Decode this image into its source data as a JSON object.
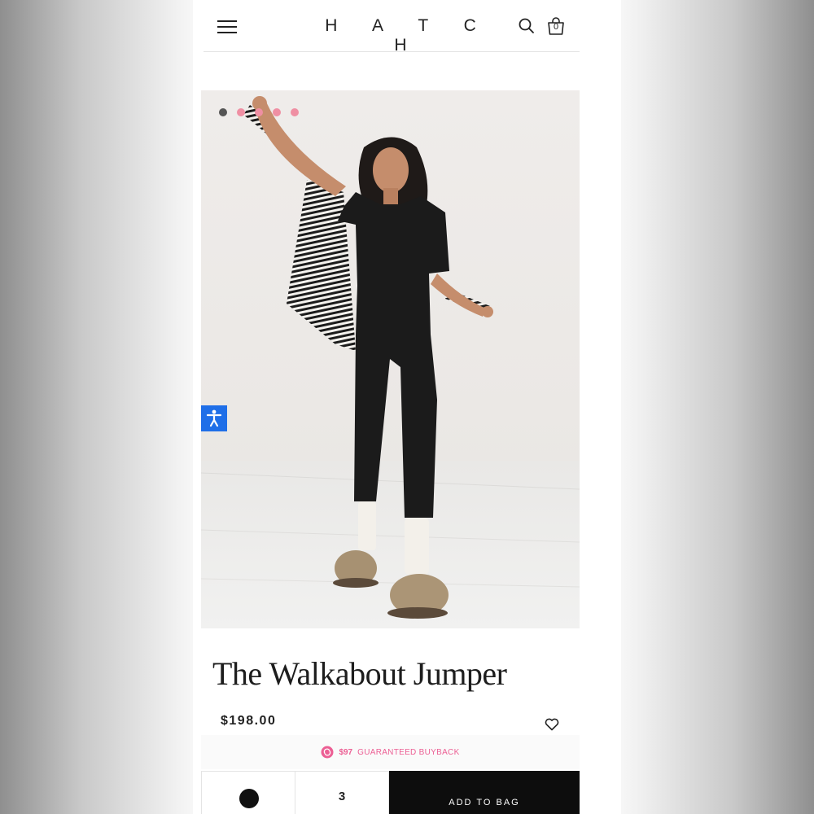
{
  "header": {
    "logo": "H A T C H",
    "menu_icon": "hamburger-menu-icon",
    "search_icon": "search-icon",
    "cart_icon": "shopping-bag-icon",
    "cart_count": "0"
  },
  "gallery": {
    "slide_count": 5,
    "active_slide": 1,
    "dot_color": "#ef8fa3",
    "active_dot_color": "#555555",
    "image_description_icon": "product-photo"
  },
  "accessibility": {
    "icon": "accessibility-icon",
    "color": "#1f6fe8"
  },
  "product": {
    "title": "The Walkabout Jumper",
    "price": "$198.00",
    "wishlist_icon": "heart-icon"
  },
  "buyback": {
    "amount": "$97",
    "label": "GUARANTEED BUYBACK",
    "color": "#ec5f94"
  },
  "purchase": {
    "swatch_color": "#111111",
    "quantity": "3",
    "add_label": "ADD TO BAG"
  }
}
